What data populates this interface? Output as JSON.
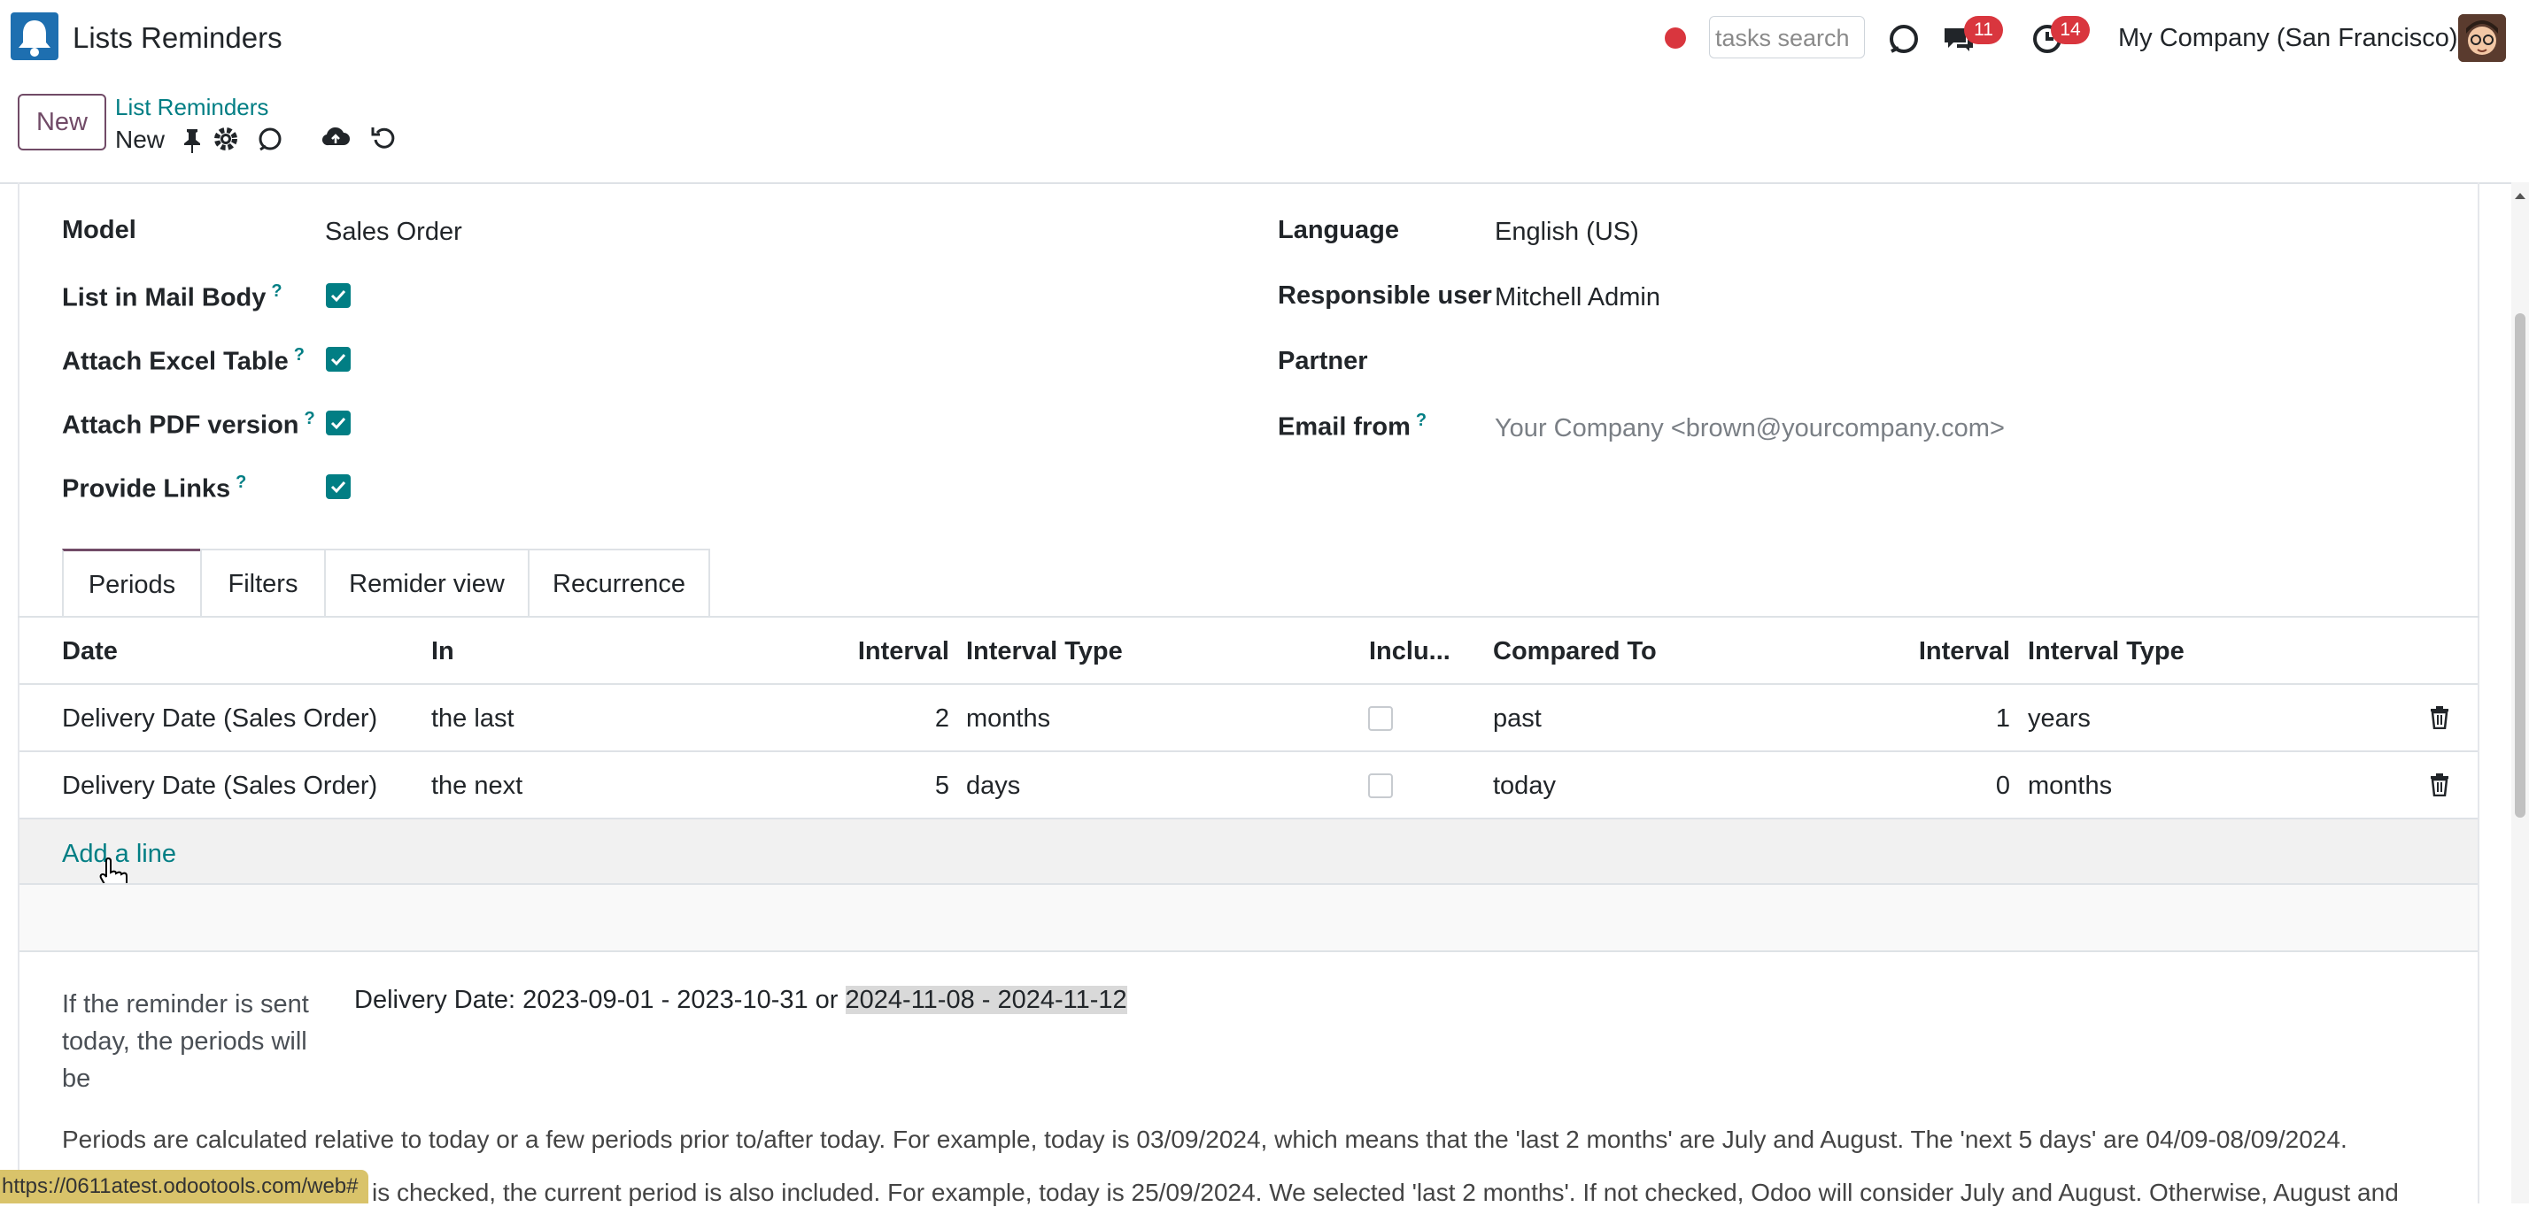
{
  "navbar": {
    "app_title": "Lists Reminders",
    "search_placeholder": "tasks search",
    "messages_count": "11",
    "activities_count": "14",
    "company": "My Company (San Francisco)"
  },
  "control_panel": {
    "new_button": "New",
    "breadcrumb_parent": "List Reminders",
    "breadcrumb_current": "New"
  },
  "form": {
    "model_label": "Model",
    "model_value": "Sales Order",
    "list_in_body_label": "List in Mail Body",
    "attach_excel_label": "Attach Excel Table",
    "attach_pdf_label": "Attach PDF version",
    "provide_links_label": "Provide Links",
    "help_marker": "?",
    "language_label": "Language",
    "language_value": "English (US)",
    "responsible_label": "Responsible user",
    "responsible_value": "Mitchell Admin",
    "partner_label": "Partner",
    "email_from_label": "Email from",
    "email_from_placeholder": "Your Company <brown@yourcompany.com>"
  },
  "tabs": [
    "Periods",
    "Filters",
    "Remider view",
    "Recurrence"
  ],
  "table": {
    "headers": [
      "Date",
      "In",
      "Interval",
      "Interval Type",
      "Inclu...",
      "Compared To",
      "Interval",
      "Interval Type"
    ],
    "rows": [
      {
        "date": "Delivery Date (Sales Order)",
        "in": "the last",
        "interval": "2",
        "interval_type": "months",
        "compared_to": "past",
        "interval2": "1",
        "interval_type2": "years"
      },
      {
        "date": "Delivery Date (Sales Order)",
        "in": "the next",
        "interval": "5",
        "interval_type": "days",
        "compared_to": "today",
        "interval2": "0",
        "interval_type2": "months"
      }
    ],
    "add_line": "Add a line"
  },
  "periods": {
    "label_line1": "If the reminder is sent",
    "label_line2": "today, the periods will",
    "label_line3": "be",
    "text_prefix": "Delivery Date: 2023-09-01 - 2023-10-31 or ",
    "text_highlight": "2024-11-08 - 2024-11-12",
    "note1": "Periods are calculated relative to today or a few periods prior to/after today. For example, today is 03/09/2024, which means that the 'last 2 months' are July and August. The 'next 5 days' are 04/09-08/09/2024.",
    "note2": "is checked, the current period is also included. For example, today is 25/09/2024. We selected 'last 2 months'. If not checked, Odoo will consider July and August. Otherwise, August and"
  },
  "status_url": "https://0611atest.odootools.com/web#"
}
